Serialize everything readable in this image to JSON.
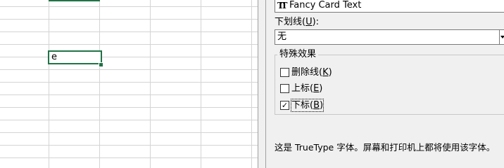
{
  "sheet": {
    "active_cell_value": "e",
    "accent_color": "#217346"
  },
  "dialog": {
    "font_item": {
      "icon": "truetype-icon",
      "icon_glyph": "TT",
      "name": "Fancy Card Text"
    },
    "underline": {
      "label_prefix": "下划线(",
      "label_hotkey": "U",
      "label_suffix": "):",
      "value": "无"
    },
    "effects": {
      "title": "特殊效果",
      "items": [
        {
          "prefix": "删除线(",
          "hotkey": "K",
          "suffix": ")",
          "checked": false
        },
        {
          "prefix": "上标(",
          "hotkey": "E",
          "suffix": ")",
          "checked": false
        },
        {
          "prefix": "下标(",
          "hotkey": "B",
          "suffix": ")",
          "checked": true
        }
      ]
    },
    "description": "这是 TrueType 字体。屏幕和打印机上都将使用该字体。"
  }
}
